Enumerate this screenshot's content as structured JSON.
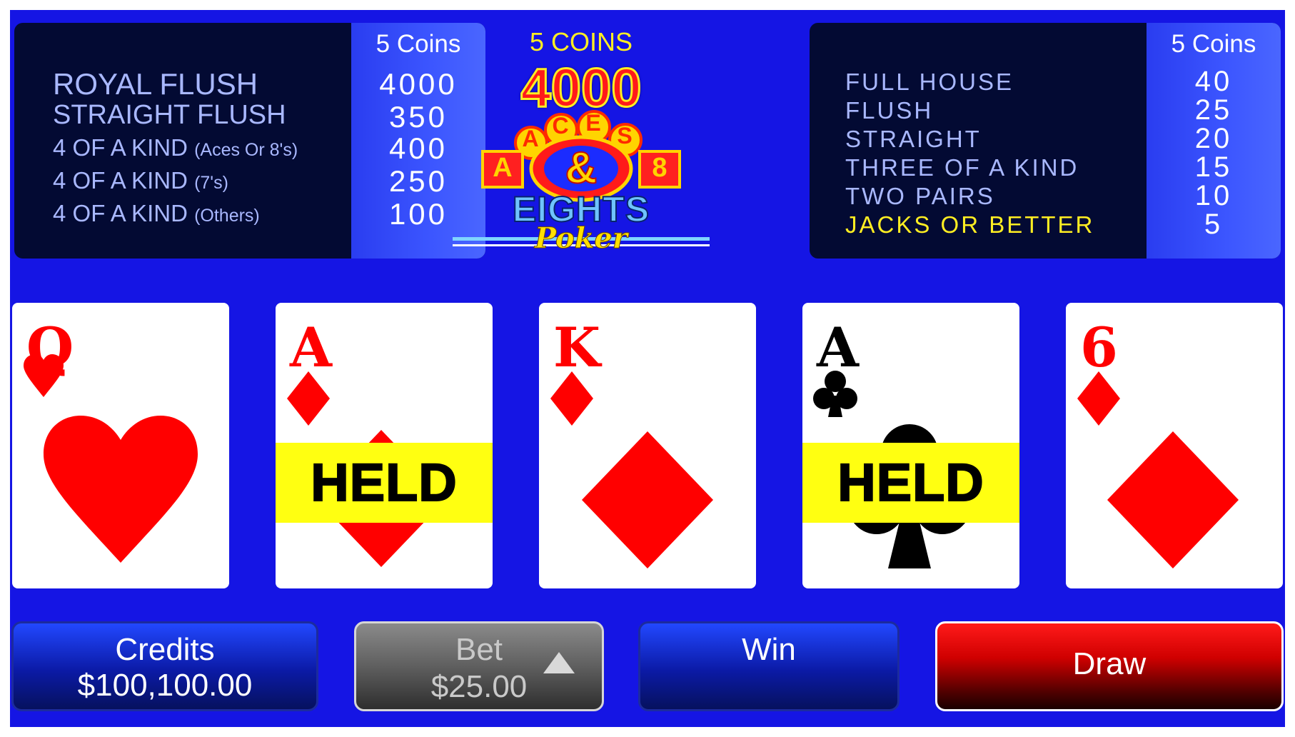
{
  "left_paytable": {
    "column_header": "5 Coins",
    "rows": [
      {
        "name": "ROYAL FLUSH",
        "qualifier": "",
        "value": "4000"
      },
      {
        "name": "STRAIGHT FLUSH",
        "qualifier": "",
        "value": "350"
      },
      {
        "name": "4 OF A KIND",
        "qualifier": "(Aces Or 8's)",
        "value": "400"
      },
      {
        "name": "4 OF A KIND",
        "qualifier": "(7's)",
        "value": "250"
      },
      {
        "name": "4 OF A KIND",
        "qualifier": "(Others)",
        "value": "100"
      }
    ]
  },
  "right_paytable": {
    "column_header": "5 Coins",
    "rows": [
      {
        "name": "FULL HOUSE",
        "value": "40"
      },
      {
        "name": "FLUSH",
        "value": "25"
      },
      {
        "name": "STRAIGHT",
        "value": "20"
      },
      {
        "name": "THREE OF A KIND",
        "value": "15"
      },
      {
        "name": "TWO PAIRS",
        "value": "10"
      },
      {
        "name": "JACKS OR BETTER",
        "value": "5"
      }
    ]
  },
  "logo": {
    "coins_label": "5 COINS",
    "jackpot": "4000",
    "word_aces": "ACES",
    "ampersand": "&",
    "left_badge": "A",
    "right_badge": "8",
    "word_eights": "EIGHTS",
    "word_poker": "Poker"
  },
  "cards": [
    {
      "rank": "Q",
      "suit": "heart",
      "color": "#ff0000",
      "held": false
    },
    {
      "rank": "A",
      "suit": "diamond",
      "color": "#ff0000",
      "held": true
    },
    {
      "rank": "K",
      "suit": "diamond",
      "color": "#ff0000",
      "held": false
    },
    {
      "rank": "A",
      "suit": "club",
      "color": "#000000",
      "held": true
    },
    {
      "rank": "6",
      "suit": "diamond",
      "color": "#ff0000",
      "held": false
    }
  ],
  "held_label": "HELD",
  "buttons": {
    "credits_label": "Credits",
    "credits_value": "$100,100.00",
    "bet_label": "Bet",
    "bet_value": "$25.00",
    "win_label": "Win",
    "draw_label": "Draw"
  },
  "colors": {
    "background": "#1515e4",
    "held_bar": "#ffff11",
    "draw_button": "#e00000",
    "jacks_or_better": "#ffee22"
  }
}
